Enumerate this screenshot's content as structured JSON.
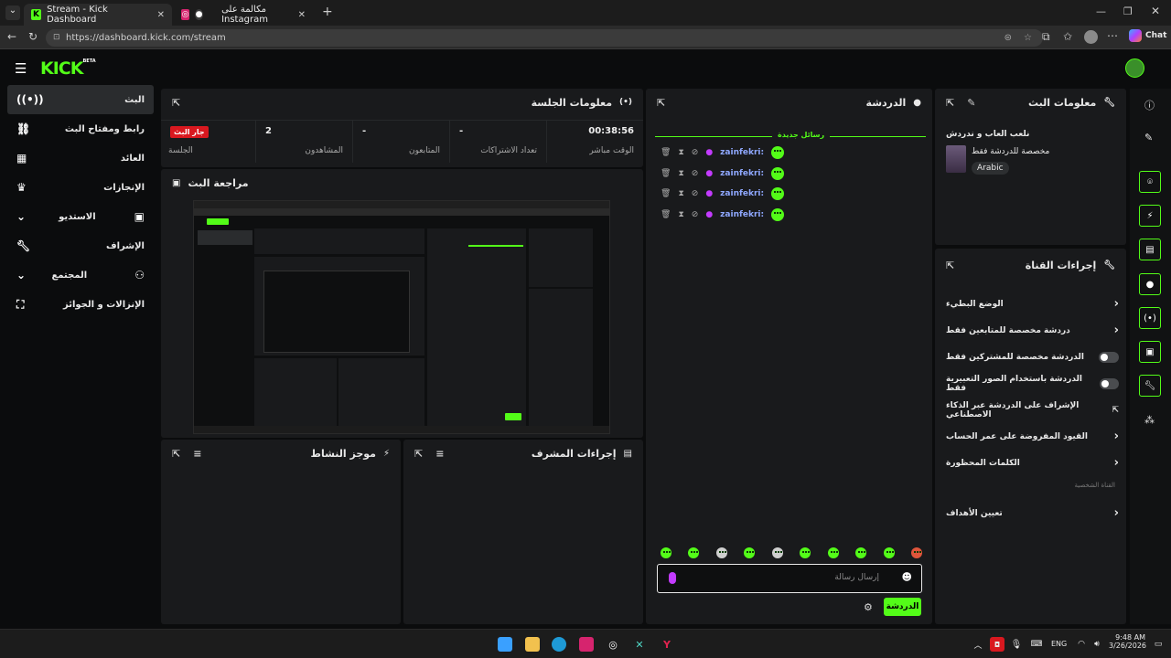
{
  "browser": {
    "tabs": [
      {
        "title": "Stream - Kick Dashboard",
        "active": true
      },
      {
        "title": "مكالمة على Instagram",
        "active": false
      }
    ],
    "url": "https://dashboard.kick.com/stream",
    "chat_button": "Chat"
  },
  "brand": {
    "logo": "KICK",
    "badge": "BETA",
    "accent": "#53fc18"
  },
  "sidebar": {
    "items": [
      {
        "label": "البث",
        "icon": "broadcast-icon",
        "active": true
      },
      {
        "label": "رابط ومفتاح البث",
        "icon": "link-icon"
      },
      {
        "label": "العائد",
        "icon": "chart-icon"
      },
      {
        "label": "الإنجازات",
        "icon": "trophy-icon"
      },
      {
        "label": "الاستديو",
        "icon": "studio-icon"
      },
      {
        "label": "الإشراف",
        "icon": "wrench-icon"
      },
      {
        "label": "المجتمع",
        "icon": "community-icon"
      },
      {
        "label": "الإنزالات و الجوائز",
        "icon": "drops-icon"
      }
    ]
  },
  "session": {
    "title": "معلومات الجلسة",
    "stats": [
      {
        "value": "00:38:56",
        "label": "الوقت مباشر"
      },
      {
        "value": "-",
        "label": "تعداد الاشتراكات"
      },
      {
        "value": "-",
        "label": "المتابعون"
      },
      {
        "value": "2",
        "label": "المشاهدون"
      },
      {
        "value": "جار البث",
        "label": "الجلسة"
      }
    ]
  },
  "preview": {
    "title": "مراجعة البث"
  },
  "activity": {
    "title": "موجز النشاط"
  },
  "mod_actions": {
    "title": "إجراءات المشرف"
  },
  "chat": {
    "title": "الدردشة",
    "new_messages": "رسائل جديدة",
    "messages": [
      {
        "user": "zainfekri:"
      },
      {
        "user": "zainfekri:"
      },
      {
        "user": "zainfekri:"
      },
      {
        "user": "zainfekri:"
      }
    ],
    "input_placeholder": "إرسال رسالة",
    "send_button": "الدردشة"
  },
  "stream_info": {
    "title": "معلومات البث",
    "stream_title": "نلعب العاب و ندردش",
    "category": "مخصصة للدردشة فقط",
    "language": "Arabic"
  },
  "channel_actions": {
    "title": "إجراءات القناة",
    "items": [
      {
        "label": "الوضع البطيء",
        "control": "chevron"
      },
      {
        "label": "دردشة مخصصة للمتابعين فقط",
        "control": "chevron"
      },
      {
        "label": "الدردشة مخصصة للمشتركين فقط",
        "control": "toggle"
      },
      {
        "label": "الدردشة باستخدام الصور التعبيرية فقط",
        "control": "toggle"
      },
      {
        "label": "الإشراف على الدردشة عبر الذكاء الاصطناعي",
        "control": "external"
      },
      {
        "label": "القيود المفروضة على عمر الحساب",
        "control": "chevron"
      },
      {
        "label": "الكلمات المحظورة",
        "control": "chevron"
      }
    ],
    "section_label": "القناة الشخصية",
    "goals_label": "تعيين الأهداف"
  },
  "taskbar": {
    "lang": "ENG",
    "time": "9:48 AM",
    "date": "3/26/2026"
  }
}
